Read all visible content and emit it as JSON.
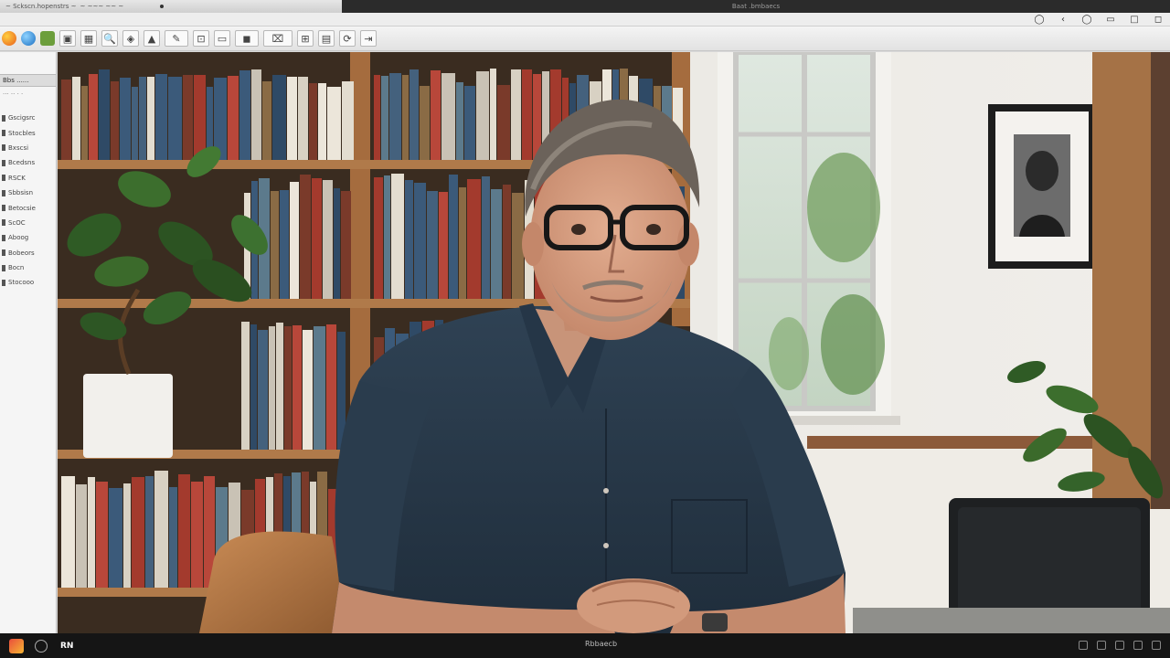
{
  "window": {
    "title_left": "~ Sckscn.hopenstrs  ~",
    "title_left_extra": "~ ~~~  ~~ ~",
    "title_center": "Baat .bmbaecs"
  },
  "window_controls": [
    "◯",
    "‹",
    "◯",
    "▭",
    "□",
    "◻"
  ],
  "toolbar": {
    "logos": [
      "app-a",
      "app-b",
      "app-c"
    ],
    "tools": [
      {
        "name": "cursor-tool",
        "glyph": "▣"
      },
      {
        "name": "image-tool",
        "glyph": "▦"
      },
      {
        "name": "zoom-tool",
        "glyph": "🔍"
      },
      {
        "name": "pan-tool",
        "glyph": "◈"
      },
      {
        "name": "shape-tool",
        "glyph": "▲"
      },
      {
        "name": "brush-tool",
        "glyph": "✎"
      },
      {
        "name": "crop-tool",
        "glyph": "⊡"
      },
      {
        "name": "frame-tool",
        "glyph": "▭"
      },
      {
        "name": "stamp-tool",
        "glyph": "◼"
      },
      {
        "name": "text-tool",
        "glyph": "⌧"
      },
      {
        "name": "grid-tool",
        "glyph": "⊞"
      },
      {
        "name": "layer-tool",
        "glyph": "▤"
      },
      {
        "name": "refresh-tool",
        "glyph": "⟳"
      },
      {
        "name": "export-tool",
        "glyph": "⇥"
      }
    ]
  },
  "left_panel": {
    "header": "Bbs  ......",
    "sub_header": "··· ·· · ·",
    "items": [
      "Gscigsrc",
      "Stocbles",
      "Bxscsi",
      "Bcedsns",
      "RSCK",
      "Sbbsisn",
      "Betocsie",
      "ScOC",
      "Aboog",
      "Bobeors",
      "Bocn",
      "Stocooo"
    ]
  },
  "taskbar": {
    "app_label": "RN",
    "center_text": "Rbbaecb"
  }
}
